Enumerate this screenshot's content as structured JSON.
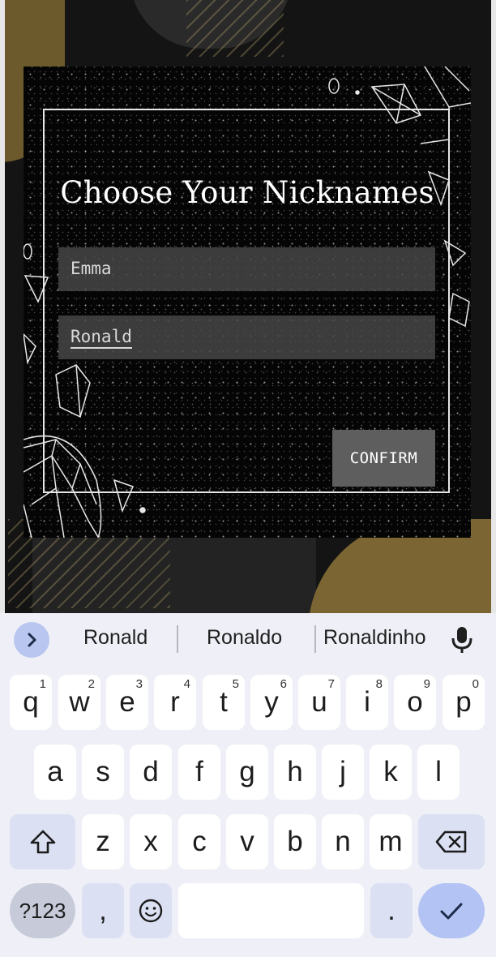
{
  "dialog": {
    "title": "Choose Your Nicknames",
    "player1_value": "Emma",
    "player2_value": "Ronald",
    "confirm_label": "CONFIRM"
  },
  "keyboard": {
    "suggestions": [
      "Ronald",
      "Ronaldo",
      "Ronaldinho"
    ],
    "row1": [
      {
        "k": "q",
        "h": "1"
      },
      {
        "k": "w",
        "h": "2"
      },
      {
        "k": "e",
        "h": "3"
      },
      {
        "k": "r",
        "h": "4"
      },
      {
        "k": "t",
        "h": "5"
      },
      {
        "k": "y",
        "h": "6"
      },
      {
        "k": "u",
        "h": "7"
      },
      {
        "k": "i",
        "h": "8"
      },
      {
        "k": "o",
        "h": "9"
      },
      {
        "k": "p",
        "h": "0"
      }
    ],
    "row2": [
      "a",
      "s",
      "d",
      "f",
      "g",
      "h",
      "j",
      "k",
      "l"
    ],
    "row3": [
      "z",
      "x",
      "c",
      "v",
      "b",
      "n",
      "m"
    ],
    "sym_label": "?123",
    "comma_label": ",",
    "period_label": ".",
    "icons": {
      "expand": "chevron-right-icon",
      "mic": "mic-icon",
      "shift": "shift-icon",
      "backspace": "backspace-icon",
      "emoji": "emoji-icon",
      "enter": "checkmark-icon"
    },
    "accent_color": "#b9c6ef"
  }
}
